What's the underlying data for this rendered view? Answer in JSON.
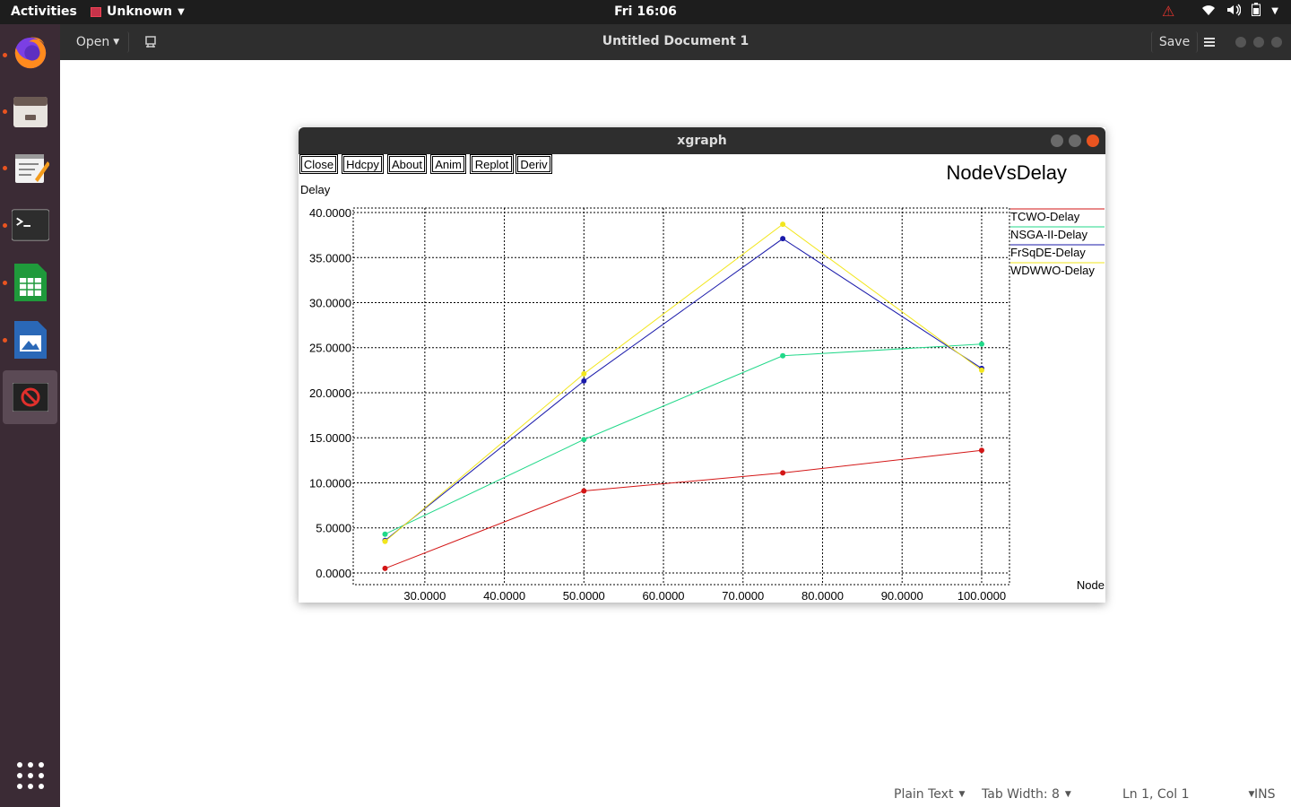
{
  "topbar": {
    "activities": "Activities",
    "app_name": "Unknown",
    "clock": "Fri 16:06",
    "tray_icons": [
      "warning-icon",
      "wifi-icon",
      "volume-icon",
      "battery-icon",
      "system-menu-icon"
    ]
  },
  "dock": {
    "items": [
      "firefox-icon",
      "files-icon",
      "text-editor-icon",
      "terminal-icon",
      "calc-icon",
      "impress-icon",
      "xgraph-icon"
    ],
    "show_apps_icon": "apps-grid-icon"
  },
  "gedit": {
    "open_label": "Open",
    "title": "Untitled Document 1",
    "save_label": "Save",
    "status": {
      "language": "Plain Text",
      "tab_width": "Tab Width: 8",
      "position": "Ln 1, Col 1",
      "mode": "INS"
    }
  },
  "xgraph": {
    "window_title": "xgraph",
    "buttons": [
      "Close",
      "Hdcpy",
      "About",
      "Anim",
      "Replot",
      "Deriv"
    ]
  },
  "chart_data": {
    "type": "line",
    "title": "NodeVsDelay",
    "xlabel": "Node",
    "ylabel": "Delay",
    "xlim": [
      21,
      103.5
    ],
    "ylim": [
      -1.3,
      40.5
    ],
    "x_ticks": [
      "30.0000",
      "40.0000",
      "50.0000",
      "60.0000",
      "70.0000",
      "80.0000",
      "90.0000",
      "100.0000"
    ],
    "y_ticks": [
      "0.0000",
      "5.0000",
      "10.0000",
      "15.0000",
      "20.0000",
      "25.0000",
      "30.0000",
      "35.0000",
      "40.0000"
    ],
    "grid": true,
    "legend_position": "right",
    "x": [
      25,
      50,
      75,
      100
    ],
    "series": [
      {
        "name": "TCWO-Delay",
        "color": "#d31616",
        "values": [
          0.5,
          9.1,
          11.1,
          13.6
        ]
      },
      {
        "name": "NSGA-II-Delay",
        "color": "#21d889",
        "values": [
          4.3,
          14.8,
          24.1,
          25.4
        ]
      },
      {
        "name": "FrSqDE-Delay",
        "color": "#1a1aaa",
        "values": [
          3.6,
          21.3,
          37.1,
          22.7
        ]
      },
      {
        "name": "WDWWO-Delay",
        "color": "#f2e61c",
        "values": [
          3.5,
          22.1,
          38.7,
          22.5
        ]
      }
    ]
  }
}
